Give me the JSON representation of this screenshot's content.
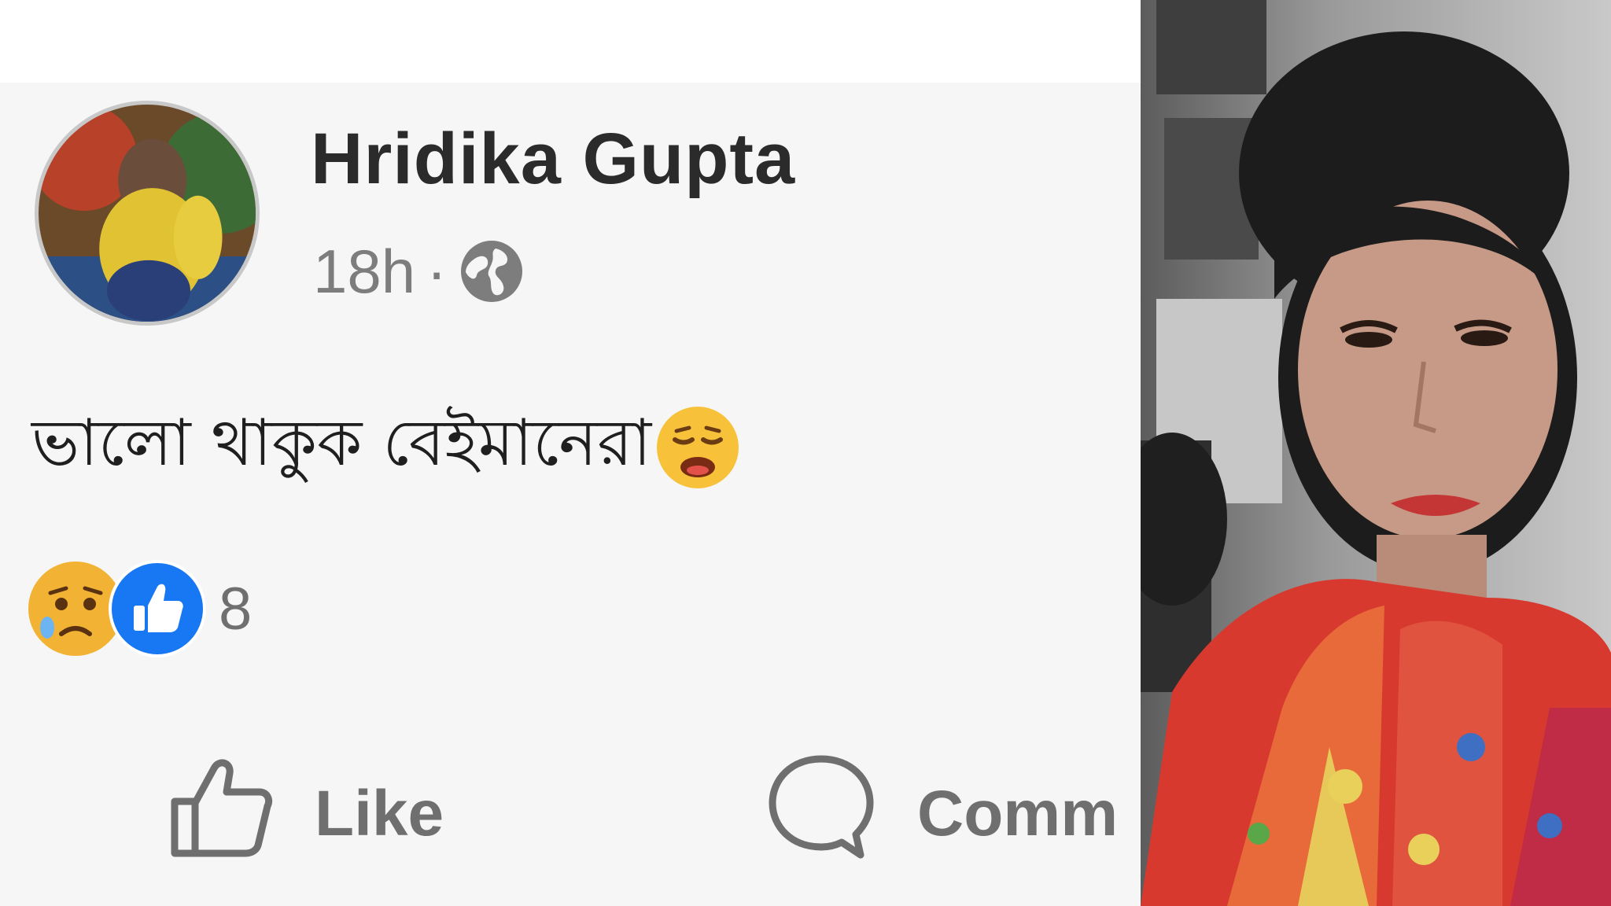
{
  "post": {
    "author": "Hridika Gupta",
    "time": "18h",
    "separator": "·",
    "privacy_icon": "globe-icon",
    "text": "ভালো থাকুক বেইমানেরা",
    "text_emoji": "tired-face-emoji",
    "reactions": {
      "icons": [
        "sad-reaction-icon",
        "like-reaction-icon"
      ],
      "count": "8"
    },
    "actions": {
      "like_label": "Like",
      "comment_label": "Comm"
    }
  },
  "colors": {
    "card_background": "#f6f6f6",
    "author_text": "#2b2b2b",
    "meta_text": "#7d7d7d",
    "like_blue": "#1877f2",
    "reaction_yellow": "#f7c23a"
  }
}
